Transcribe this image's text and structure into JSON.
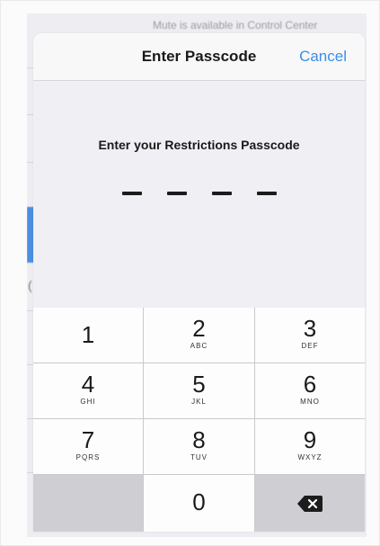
{
  "background": {
    "top_text": "Mute is available in Control Center"
  },
  "modal": {
    "title": "Enter Passcode",
    "cancel_label": "Cancel",
    "prompt": "Enter your Restrictions Passcode"
  },
  "keypad": {
    "keys": [
      {
        "digit": "1",
        "letters": ""
      },
      {
        "digit": "2",
        "letters": "ABC"
      },
      {
        "digit": "3",
        "letters": "DEF"
      },
      {
        "digit": "4",
        "letters": "GHI"
      },
      {
        "digit": "5",
        "letters": "JKL"
      },
      {
        "digit": "6",
        "letters": "MNO"
      },
      {
        "digit": "7",
        "letters": "PQRS"
      },
      {
        "digit": "8",
        "letters": "TUV"
      },
      {
        "digit": "9",
        "letters": "WXYZ"
      },
      {
        "digit": "0",
        "letters": ""
      }
    ],
    "delete_icon": "backspace-icon"
  },
  "colors": {
    "accent": "#3b8ee8",
    "key_bg": "#fdfdfd",
    "keypad_divider": "#c9c9cf"
  }
}
